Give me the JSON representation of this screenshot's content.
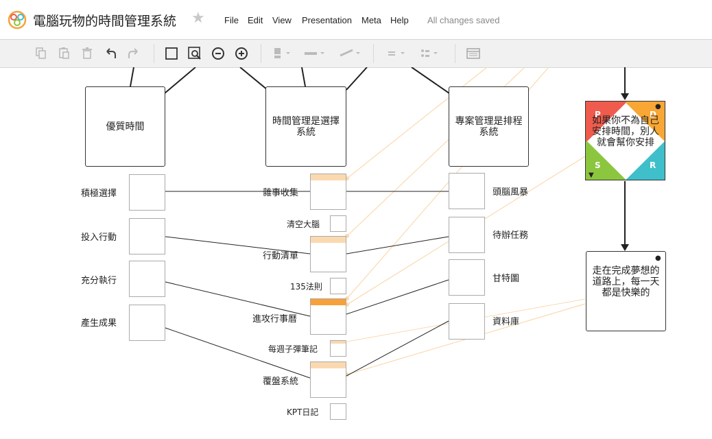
{
  "app": {
    "title": "電腦玩物的時間管理系統",
    "menu": [
      "File",
      "Edit",
      "View",
      "Presentation",
      "Meta",
      "Help"
    ],
    "status": "All changes saved"
  },
  "toolbar": {
    "buttons": [
      "copy-icon",
      "paste-icon",
      "delete-icon",
      "undo-icon",
      "redo-icon",
      "box-icon",
      "zoom-fit-icon",
      "zoom-out-icon",
      "zoom-in-icon",
      "fill-color-icon",
      "line-style-icon",
      "line-color-icon",
      "align-icon",
      "layout-icon",
      "panel-icon"
    ]
  },
  "colors": {
    "accent": "#f7a13b",
    "link": "#fbd9b0",
    "p": "#ef5b4c",
    "d": "#f8a634",
    "s": "#8cc63f",
    "r": "#3fbfc9"
  },
  "topics": {
    "quality_time": "優質時間",
    "time_mgmt": "時間管理是選擇系統",
    "project_mgmt": "專案管理是排程系統",
    "pdsr_text": "如果你不為自己安排時間，別人就會幫你安排",
    "goal": "走在完成夢想的道路上，每一天都是快樂的"
  },
  "pdsr": {
    "p": "P",
    "d": "D",
    "s": "S",
    "r": "R"
  },
  "left_labels": [
    "積極選擇",
    "投入行動",
    "充分執行",
    "產生成果"
  ],
  "mid_labels": [
    "雜事收集",
    "清空大腦",
    "行動清單",
    "135法則",
    "進攻行事曆",
    "每週子彈筆記",
    "覆盤系統",
    "KPT日記"
  ],
  "right_labels": [
    "頭腦風暴",
    "待辦任務",
    "甘特圖",
    "資料庫"
  ]
}
